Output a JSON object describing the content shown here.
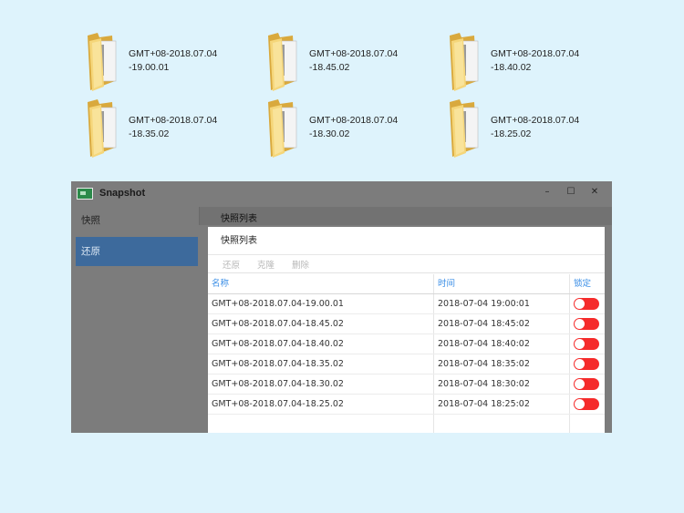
{
  "folders": [
    {
      "line1": "GMT+08-2018.07.04",
      "line2": "-19.00.01"
    },
    {
      "line1": "GMT+08-2018.07.04",
      "line2": "-18.45.02"
    },
    {
      "line1": "GMT+08-2018.07.04",
      "line2": "-18.40.02"
    },
    {
      "line1": "GMT+08-2018.07.04",
      "line2": "-18.35.02"
    },
    {
      "line1": "GMT+08-2018.07.04",
      "line2": "-18.30.02"
    },
    {
      "line1": "GMT+08-2018.07.04",
      "line2": "-18.25.02"
    }
  ],
  "window": {
    "title": "Snapshot",
    "controls": {
      "minimize": "–",
      "maximize": "☐",
      "close": "✕"
    },
    "sidebar": [
      {
        "label": "快照"
      },
      {
        "label": "还原"
      }
    ],
    "content_header": "快照列表"
  },
  "dialog": {
    "title": "快照列表",
    "toolbar": {
      "restore": "还原",
      "clone": "克隆",
      "delete": "删除"
    },
    "columns": {
      "name": "名称",
      "time": "时间",
      "lock": "锁定"
    },
    "rows": [
      {
        "name": "GMT+08-2018.07.04-19.00.01",
        "time": "2018-07-04 19:00:01"
      },
      {
        "name": "GMT+08-2018.07.04-18.45.02",
        "time": "2018-07-04 18:45:02"
      },
      {
        "name": "GMT+08-2018.07.04-18.40.02",
        "time": "2018-07-04 18:40:02"
      },
      {
        "name": "GMT+08-2018.07.04-18.35.02",
        "time": "2018-07-04 18:35:02"
      },
      {
        "name": "GMT+08-2018.07.04-18.30.02",
        "time": "2018-07-04 18:30:02"
      },
      {
        "name": "GMT+08-2018.07.04-18.25.02",
        "time": "2018-07-04 18:25:02"
      }
    ]
  },
  "colors": {
    "background": "#def3fc",
    "active_sidebar": "#3d6a9c",
    "toggle_on": "#f52b2b",
    "header_text": "#3a8ee6"
  }
}
